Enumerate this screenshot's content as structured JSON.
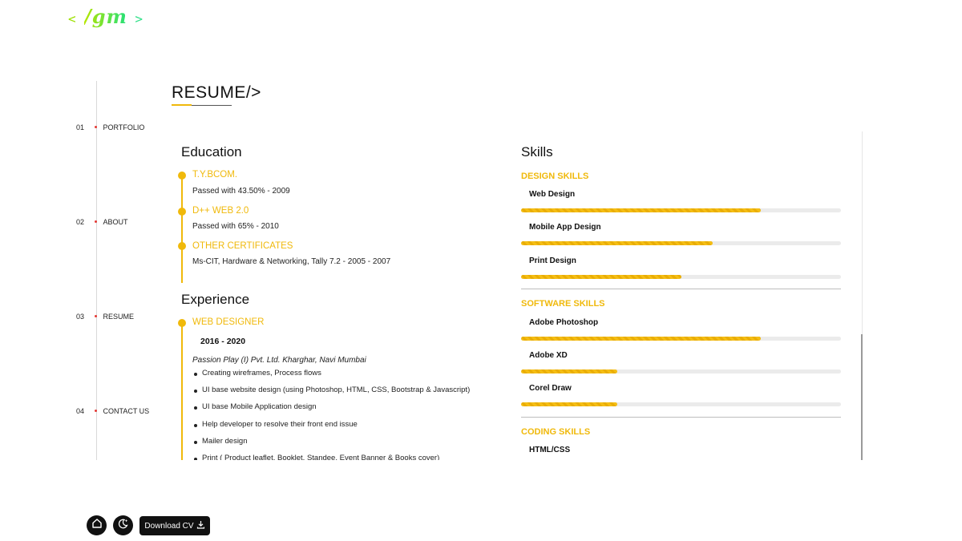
{
  "logo": {
    "open": "<",
    "mark": "/gm",
    "close": ">"
  },
  "nav": [
    {
      "num": "01",
      "label": "PORTFOLIO"
    },
    {
      "num": "02",
      "label": "ABOUT"
    },
    {
      "num": "03",
      "label": "RESUME"
    },
    {
      "num": "04",
      "label": "CONTACT US"
    }
  ],
  "page_title": "RESUME/>",
  "education": {
    "heading": "Education",
    "items": [
      {
        "title": "T.Y.BCOM.",
        "detail": "Passed with 43.50% - 2009"
      },
      {
        "title": "D++ WEB 2.0",
        "detail": "Passed with 65% - 2010"
      },
      {
        "title": "OTHER CERTIFICATES",
        "detail": "Ms-CIT, Hardware & Networking, Tally 7.2 - 2005 - 2007"
      }
    ]
  },
  "experience": {
    "heading": "Experience",
    "role": "WEB DESIGNER",
    "years": "2016 - 2020",
    "company": "Passion Play (I) Pvt. Ltd. Kharghar, Navi Mumbai",
    "duties": [
      "Creating wireframes, Process flows",
      "UI base website design (using Photoshop, HTML, CSS, Bootstrap & Javascript)",
      "UI base Mobile Application design",
      "Help developer to resolve their front end issue",
      "Mailer design",
      "Print ( Product leaflet, Booklet, Standee, Event Banner & Books cover)"
    ]
  },
  "skills": {
    "heading": "Skills",
    "groups": [
      {
        "name": "DESIGN SKILLS",
        "items": [
          {
            "name": "Web Design",
            "level": 75
          },
          {
            "name": "Mobile App Design",
            "level": 60
          },
          {
            "name": "Print Design",
            "level": 50
          }
        ]
      },
      {
        "name": "SOFTWARE SKILLS",
        "items": [
          {
            "name": "Adobe Photoshop",
            "level": 75
          },
          {
            "name": "Adobe XD",
            "level": 30
          },
          {
            "name": "Corel Draw",
            "level": 30
          }
        ]
      },
      {
        "name": "CODING SKILLS",
        "items": [
          {
            "name": "HTML/CSS",
            "level": null
          }
        ]
      }
    ]
  },
  "footer": {
    "download_label": "Download CV"
  },
  "icons": {
    "home": "home-icon",
    "theme": "moon-icon",
    "download": "download-icon"
  },
  "colors": {
    "accent": "#f0b90b",
    "dark": "#111111"
  }
}
